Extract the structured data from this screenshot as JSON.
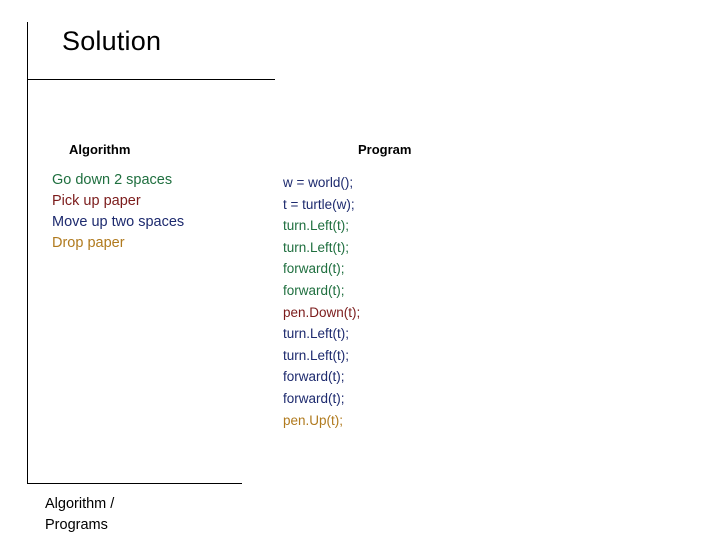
{
  "slide": {
    "title": "Solution",
    "columns": {
      "algorithm_header": "Algorithm",
      "program_header": "Program"
    },
    "algorithm_steps": [
      {
        "text": "Go down 2 spaces",
        "color": "#1f6f3f"
      },
      {
        "text": "Pick up paper",
        "color": "#7b1b1b"
      },
      {
        "text": "Move up two spaces",
        "color": "#1d2a6e"
      },
      {
        "text": "Drop paper",
        "color": "#b07a1e"
      }
    ],
    "program_lines": [
      {
        "text": "w = world();",
        "color": "#1d2a6e"
      },
      {
        "text": "t = turtle(w);",
        "color": "#1d2a6e"
      },
      {
        "text": "turn.Left(t);",
        "color": "#1f6f3f"
      },
      {
        "text": "turn.Left(t);",
        "color": "#1f6f3f"
      },
      {
        "text": "forward(t);",
        "color": "#1f6f3f"
      },
      {
        "text": "forward(t);",
        "color": "#1f6f3f"
      },
      {
        "text": "pen.Down(t);",
        "color": "#7b1b1b"
      },
      {
        "text": "turn.Left(t);",
        "color": "#1d2a6e"
      },
      {
        "text": "turn.Left(t);",
        "color": "#1d2a6e"
      },
      {
        "text": "forward(t);",
        "color": "#1d2a6e"
      },
      {
        "text": "forward(t);",
        "color": "#1d2a6e"
      },
      {
        "text": "pen.Up(t);",
        "color": "#b07a1e"
      }
    ],
    "footer": {
      "line1": "Algorithm /",
      "line2": "Programs"
    }
  }
}
